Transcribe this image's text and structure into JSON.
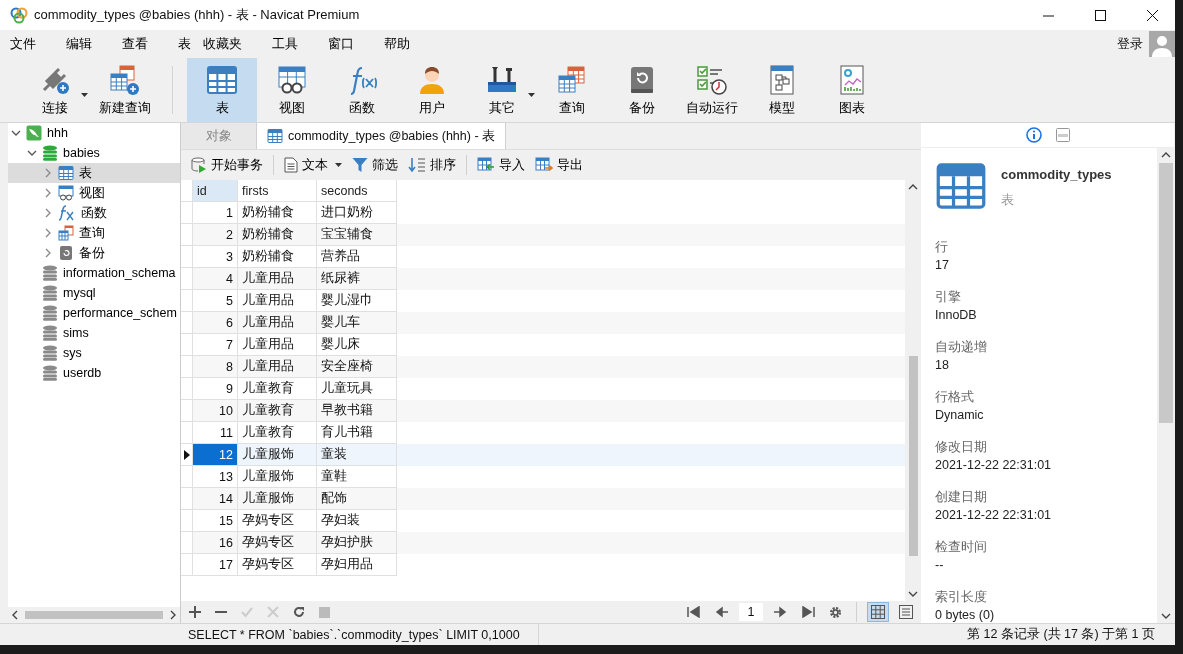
{
  "window": {
    "title": "commodity_types @babies (hhh) - 表 - Navicat Premium"
  },
  "menu": [
    "文件",
    "编辑",
    "查看",
    "表",
    "收藏夹",
    "工具",
    "窗口",
    "帮助"
  ],
  "account": {
    "label": "登录"
  },
  "toolbar": [
    {
      "kind": "connect",
      "label": "连接",
      "selected": false,
      "dropdown": true
    },
    {
      "kind": "new-query",
      "label": "新建查询",
      "selected": false,
      "dropdown": false
    },
    {
      "kind": "table",
      "label": "表",
      "selected": true,
      "dropdown": false
    },
    {
      "kind": "view",
      "label": "视图",
      "selected": false,
      "dropdown": false
    },
    {
      "kind": "function",
      "label": "函数",
      "selected": false,
      "dropdown": false
    },
    {
      "kind": "user",
      "label": "用户",
      "selected": false,
      "dropdown": false
    },
    {
      "kind": "tools",
      "label": "其它",
      "selected": false,
      "dropdown": true
    },
    {
      "kind": "query",
      "label": "查询",
      "selected": false,
      "dropdown": false
    },
    {
      "kind": "backup",
      "label": "备份",
      "selected": false,
      "dropdown": false
    },
    {
      "kind": "schedule",
      "label": "自动运行",
      "selected": false,
      "dropdown": false
    },
    {
      "kind": "model",
      "label": "模型",
      "selected": false,
      "dropdown": false
    },
    {
      "kind": "chart",
      "label": "图表",
      "selected": false,
      "dropdown": false
    }
  ],
  "tree": [
    {
      "kind": "connection",
      "label": "hhh",
      "expanded": true,
      "selected": false,
      "children": [
        {
          "kind": "database",
          "label": "babies",
          "expanded": true,
          "selected": false,
          "children": [
            {
              "kind": "table",
              "label": "表",
              "expanded": false,
              "selected": true
            },
            {
              "kind": "view",
              "label": "视图",
              "expanded": false,
              "selected": false
            },
            {
              "kind": "function",
              "label": "函数",
              "expanded": false,
              "selected": false
            },
            {
              "kind": "query",
              "label": "查询",
              "expanded": false,
              "selected": false
            },
            {
              "kind": "backup",
              "label": "备份",
              "expanded": false,
              "selected": false
            }
          ]
        },
        {
          "kind": "database-closed",
          "label": "information_schema",
          "selected": false
        },
        {
          "kind": "database-closed",
          "label": "mysql",
          "selected": false
        },
        {
          "kind": "database-closed",
          "label": "performance_schem",
          "selected": false
        },
        {
          "kind": "database-closed",
          "label": "sims",
          "selected": false
        },
        {
          "kind": "database-closed",
          "label": "sys",
          "selected": false
        },
        {
          "kind": "database-closed",
          "label": "userdb",
          "selected": false
        }
      ]
    }
  ],
  "tabs": [
    {
      "label": "对象",
      "selected": false,
      "kind": "plain"
    },
    {
      "label": "commodity_types @babies (hhh) - 表",
      "selected": true,
      "kind": "table"
    }
  ],
  "table_toolbar": [
    {
      "kind": "transaction",
      "label": "开始事务",
      "dropdown": false
    },
    {
      "kind": "text",
      "label": "文本",
      "dropdown": true
    },
    {
      "kind": "filter",
      "label": "筛选",
      "dropdown": false
    },
    {
      "kind": "sort",
      "label": "排序",
      "dropdown": false
    },
    {
      "kind": "import",
      "label": "导入",
      "dropdown": false
    },
    {
      "kind": "export",
      "label": "导出",
      "dropdown": false
    }
  ],
  "table": {
    "columns": [
      "id",
      "firsts",
      "seconds"
    ],
    "rows": [
      {
        "cells": [
          "1",
          "奶粉辅食",
          "进口奶粉"
        ],
        "selected": false
      },
      {
        "cells": [
          "2",
          "奶粉辅食",
          "宝宝辅食"
        ],
        "selected": false
      },
      {
        "cells": [
          "3",
          "奶粉辅食",
          "营养品"
        ],
        "selected": false
      },
      {
        "cells": [
          "4",
          "儿童用品",
          "纸尿裤"
        ],
        "selected": false
      },
      {
        "cells": [
          "5",
          "儿童用品",
          "婴儿湿巾"
        ],
        "selected": false
      },
      {
        "cells": [
          "6",
          "儿童用品",
          "婴儿车"
        ],
        "selected": false
      },
      {
        "cells": [
          "7",
          "儿童用品",
          "婴儿床"
        ],
        "selected": false
      },
      {
        "cells": [
          "8",
          "儿童用品",
          "安全座椅"
        ],
        "selected": false
      },
      {
        "cells": [
          "9",
          "儿童教育",
          "儿童玩具"
        ],
        "selected": false
      },
      {
        "cells": [
          "10",
          "儿童教育",
          "早教书籍"
        ],
        "selected": false
      },
      {
        "cells": [
          "11",
          "儿童教育",
          "育儿书籍"
        ],
        "selected": false
      },
      {
        "cells": [
          "12",
          "儿童服饰",
          "童装"
        ],
        "selected": true
      },
      {
        "cells": [
          "13",
          "儿童服饰",
          "童鞋"
        ],
        "selected": false
      },
      {
        "cells": [
          "14",
          "儿童服饰",
          "配饰"
        ],
        "selected": false
      },
      {
        "cells": [
          "15",
          "孕妈专区",
          "孕妇装"
        ],
        "selected": false
      },
      {
        "cells": [
          "16",
          "孕妈专区",
          "孕妇护肤"
        ],
        "selected": false
      },
      {
        "cells": [
          "17",
          "孕妈专区",
          "孕妇用品"
        ],
        "selected": false
      }
    ]
  },
  "pager": {
    "page": "1"
  },
  "view_modes": [
    {
      "kind": "grid",
      "selected": true
    },
    {
      "kind": "form",
      "selected": false
    }
  ],
  "info_panel": {
    "tabs": [
      {
        "kind": "info",
        "selected": true
      },
      {
        "kind": "ddl",
        "selected": false
      }
    ],
    "title": "commodity_types",
    "subtitle": "表",
    "properties": [
      {
        "label": "行",
        "value": "17"
      },
      {
        "label": "引擎",
        "value": "InnoDB"
      },
      {
        "label": "自动递增",
        "value": "18"
      },
      {
        "label": "行格式",
        "value": "Dynamic"
      },
      {
        "label": "修改日期",
        "value": "2021-12-22 22:31:01"
      },
      {
        "label": "创建日期",
        "value": "2021-12-22 22:31:01"
      },
      {
        "label": "检查时间",
        "value": "--"
      },
      {
        "label": "索引长度",
        "value": "0 bytes (0)"
      }
    ]
  },
  "status_bar": {
    "sql": "SELECT * FROM `babies`.`commodity_types` LIMIT 0,1000",
    "record": "第 12 条记录 (共 17 条) 于第 1 页"
  }
}
